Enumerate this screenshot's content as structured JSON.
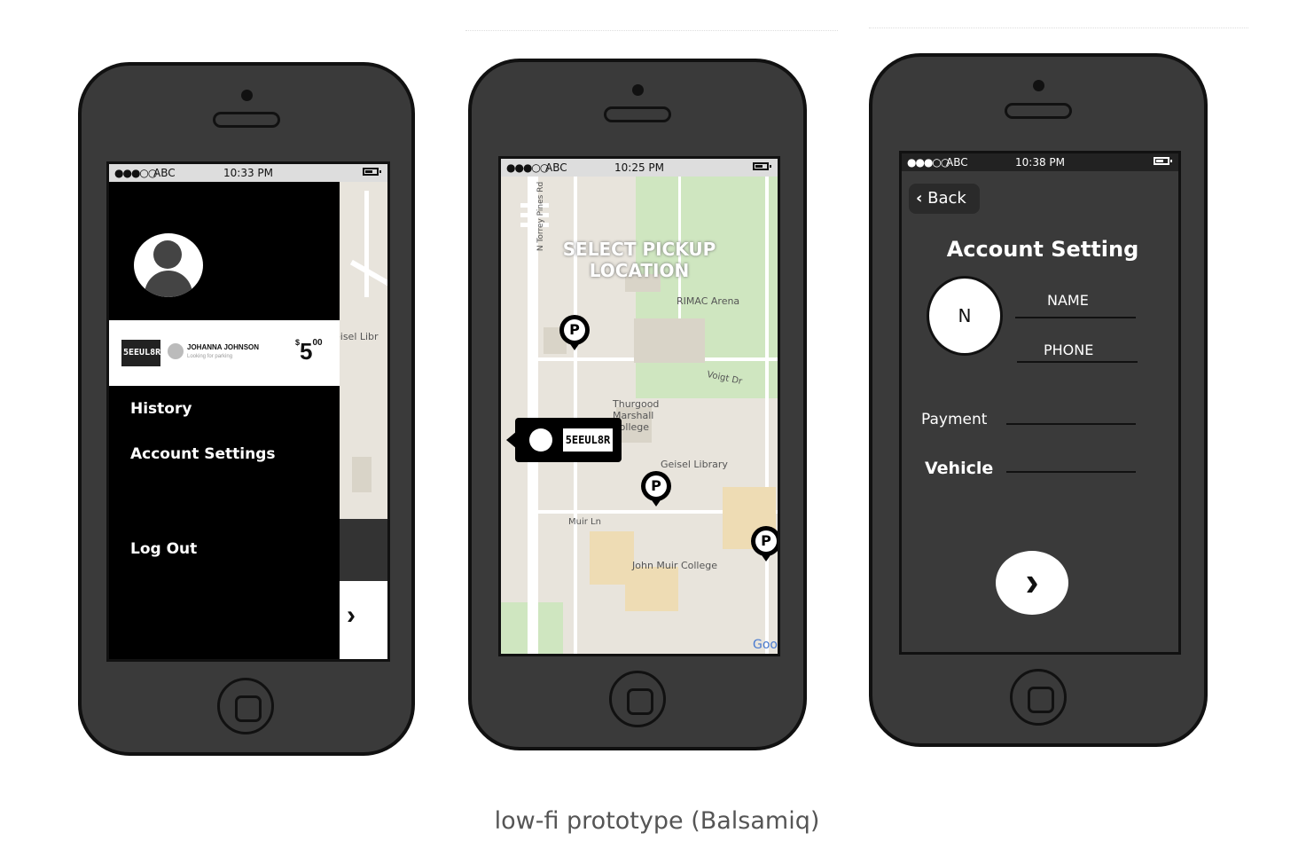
{
  "phone1": {
    "status": {
      "signal": "●●●○○",
      "carrier": "ABC",
      "time": "10:33 PM"
    },
    "profile": {
      "plate_text": "5EEUL8R",
      "user_name": "JOHANNA JOHNSON",
      "user_sub": "Looking for parking",
      "price_symbol": "$",
      "price_main": "5",
      "price_cents": "00"
    },
    "map_peek_text": "eisel Libr",
    "menu": {
      "items": [
        "History",
        "Account Settings",
        "Log Out"
      ]
    },
    "next_arrow": "›"
  },
  "phone2": {
    "status": {
      "signal": "●●●○○",
      "carrier": "ABC",
      "time": "10:25 PM"
    },
    "overlay": {
      "line1": "SELECT PICKUP",
      "line2": "LOCATION"
    },
    "map_labels": {
      "rimac": "RIMAC Arena",
      "thurgood1": "Thurgood",
      "thurgood2": "Marshall",
      "thurgood3": "College",
      "geisel": "Geisel Library",
      "muir_ln": "Muir Ln",
      "john_muir": "John Muir College",
      "voigt": "Voigt Dr",
      "torrey": "N Torrey Pines Rd",
      "google": "Goo"
    },
    "pins": [
      "P",
      "P",
      "P"
    ],
    "car_plate": "5EEUL8R"
  },
  "phone3": {
    "status": {
      "signal": "●●●○○",
      "carrier": "ABC",
      "time": "10:38 PM"
    },
    "back_label": "Back",
    "title": "Account Setting",
    "avatar_initial": "N",
    "fields": {
      "name": "NAME",
      "phone": "PHONE",
      "payment": "Payment",
      "vehicle": "Vehicle"
    },
    "next_arrow": "›"
  },
  "caption": "low-fi prototype (Balsamiq)",
  "colors": {
    "phone_body": "#3a3a3a",
    "map_bg": "#e8e4dc",
    "park_green": "#cfe6c0"
  }
}
